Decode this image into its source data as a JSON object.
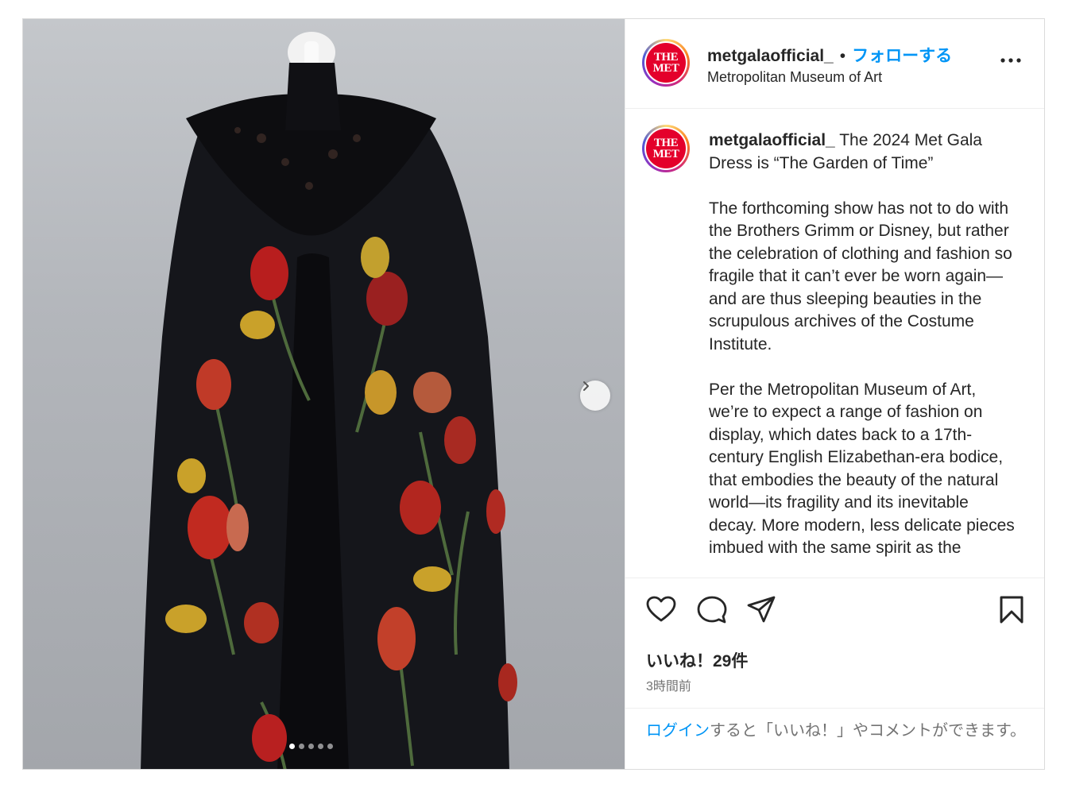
{
  "account": {
    "username": "metgalaofficial_",
    "separator": "•",
    "follow_label": "フォローする",
    "location": "Metropolitan Museum of Art",
    "avatar_text_line1": "THE",
    "avatar_text_line2": "MET"
  },
  "caption": {
    "username": "metgalaofficial_",
    "first_line": "The 2024 Met Gala Dress is “The Garden of Time”",
    "paragraph2": "The forthcoming show has not to do with the Brothers Grimm or Disney, but rather the celebration of clothing and fashion so fragile that it can’t ever be worn again—and are thus sleeping beauties in the scrupulous archives of the Costume Institute.",
    "paragraph3": "Per the Metropolitan Museum of Art, we’re to expect a range of fashion on display, which dates back to a 17th-century English Elizabethan-era bodice, that embodies the beauty of the natural world—its fragility and its inevitable decay. More modern, less delicate pieces imbued with the same spirit as the"
  },
  "actions": {
    "like_icon": "heart-icon",
    "comment_icon": "comment-icon",
    "share_icon": "paper-plane-icon",
    "save_icon": "bookmark-icon"
  },
  "likes_text": "いいね！29件",
  "time_text": "3時間前",
  "login_prompt": {
    "link": "ログイン",
    "rest": "すると「いいね！」やコメントができます。"
  },
  "carousel": {
    "total_slides": 5,
    "current_slide": 1
  },
  "colors": {
    "accent_blue": "#0095f6",
    "met_red": "#e4002b"
  }
}
